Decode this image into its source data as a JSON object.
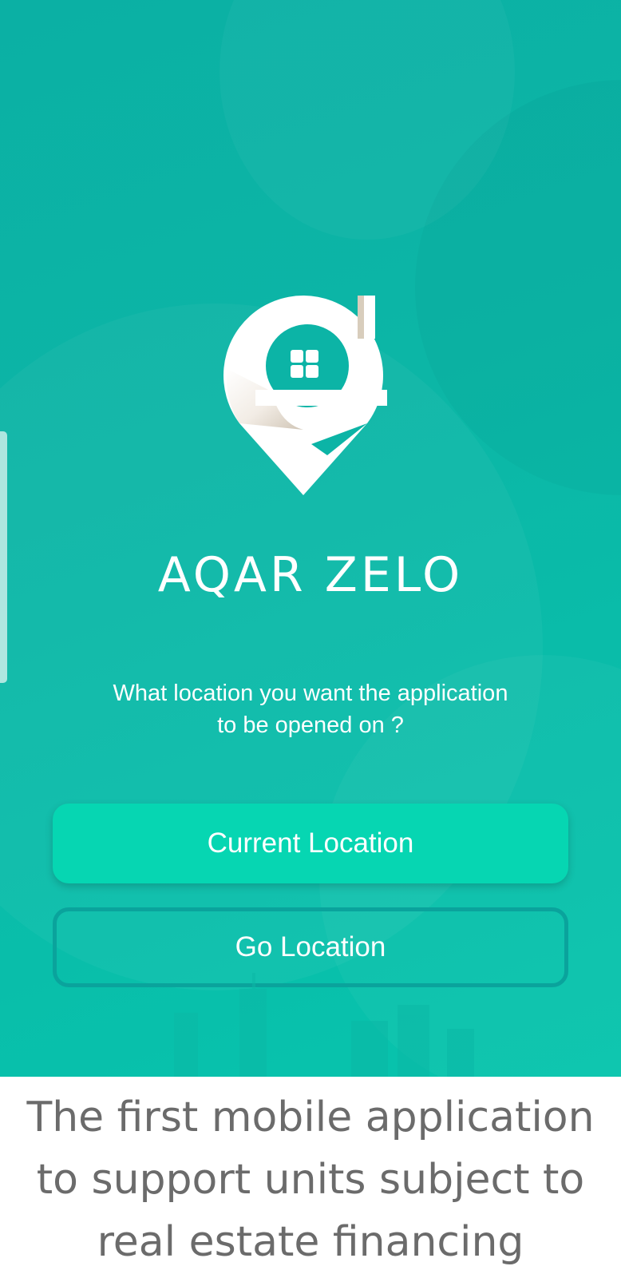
{
  "app": {
    "brand_name": "AQAR ZELO",
    "logo": "aqar-zelo-location-pin-logo"
  },
  "location_prompt": {
    "line1": "What location you want the application",
    "line2": "to be opened on ?"
  },
  "buttons": {
    "current_location": "Current Location",
    "go_location": "Go Location"
  },
  "caption": {
    "line1": "The first mobile application",
    "line2": "to support units subject to",
    "line3": "real estate financing"
  },
  "colors": {
    "background": "#0cb6a6",
    "primary_button": "#06d6b2",
    "outline_button_border": "#0aa39c",
    "caption_text": "#6b6b6b"
  }
}
